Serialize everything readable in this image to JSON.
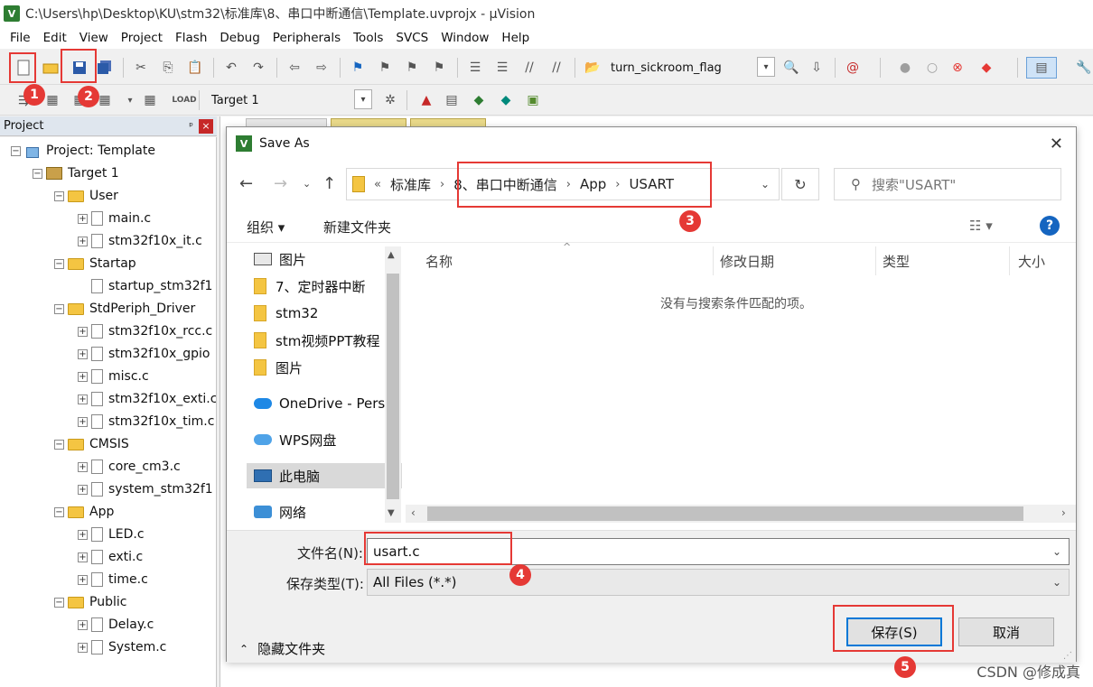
{
  "app": {
    "title": "C:\\Users\\hp\\Desktop\\KU\\stm32\\标准库\\8、串口中断通信\\Template.uvprojx - µVision",
    "icon_text": "V"
  },
  "menu": [
    "File",
    "Edit",
    "View",
    "Project",
    "Flash",
    "Debug",
    "Peripherals",
    "Tools",
    "SVCS",
    "Window",
    "Help"
  ],
  "toolbar": {
    "find_combo": "turn_sickroom_flag",
    "target_combo": "Target 1"
  },
  "project_panel": {
    "title": "Project",
    "pin": "ᵖ",
    "close": "×",
    "tree": [
      {
        "label": "Project: Template",
        "kind": "project",
        "pm": "−"
      },
      {
        "label": "Target 1",
        "kind": "target",
        "pm": "−"
      },
      {
        "label": "User",
        "kind": "folder",
        "pm": "−"
      },
      {
        "label": "main.c",
        "kind": "file",
        "pm": "+"
      },
      {
        "label": "stm32f10x_it.c",
        "kind": "file",
        "pm": "+"
      },
      {
        "label": "Startap",
        "kind": "folder",
        "pm": "−"
      },
      {
        "label": "startup_stm32f1",
        "kind": "file",
        "pm": ""
      },
      {
        "label": "StdPeriph_Driver",
        "kind": "folder",
        "pm": "−"
      },
      {
        "label": "stm32f10x_rcc.c",
        "kind": "file",
        "pm": "+"
      },
      {
        "label": "stm32f10x_gpio",
        "kind": "file",
        "pm": "+"
      },
      {
        "label": "misc.c",
        "kind": "file",
        "pm": "+"
      },
      {
        "label": "stm32f10x_exti.c",
        "kind": "file",
        "pm": "+"
      },
      {
        "label": "stm32f10x_tim.c",
        "kind": "file",
        "pm": "+"
      },
      {
        "label": "CMSIS",
        "kind": "folder",
        "pm": "−"
      },
      {
        "label": "core_cm3.c",
        "kind": "file",
        "pm": "+"
      },
      {
        "label": "system_stm32f1",
        "kind": "file",
        "pm": "+"
      },
      {
        "label": "App",
        "kind": "folder",
        "pm": "−"
      },
      {
        "label": "LED.c",
        "kind": "file",
        "pm": "+"
      },
      {
        "label": "exti.c",
        "kind": "file",
        "pm": "+"
      },
      {
        "label": "time.c",
        "kind": "file",
        "pm": "+"
      },
      {
        "label": "Public",
        "kind": "folder",
        "pm": "−"
      },
      {
        "label": "Delay.c",
        "kind": "file",
        "pm": "+"
      },
      {
        "label": "System.c",
        "kind": "file",
        "pm": "+"
      }
    ]
  },
  "dialog": {
    "title": "Save As",
    "close": "✕",
    "address": {
      "prefix": "«",
      "crumbs": [
        "标准库",
        "8、串口中断通信",
        "App",
        "USART"
      ]
    },
    "search_placeholder": "搜索\"USART\"",
    "organize": "组织 ▾",
    "new_folder": "新建文件夹",
    "help": "?",
    "nav_items": [
      {
        "label": "图片",
        "icon": "picture-icon"
      },
      {
        "label": "7、定时器中断",
        "icon": "folder-icon"
      },
      {
        "label": "stm32",
        "icon": "folder-icon"
      },
      {
        "label": "stm视频PPT教程",
        "icon": "folder-icon"
      },
      {
        "label": "图片",
        "icon": "folder-icon"
      },
      {
        "label": "OneDrive - Perso",
        "icon": "onedrive-icon"
      },
      {
        "label": "WPS网盘",
        "icon": "wps-cloud-icon"
      },
      {
        "label": "此电脑",
        "icon": "this-pc-icon"
      },
      {
        "label": "网络",
        "icon": "network-icon"
      }
    ],
    "columns": [
      "名称",
      "修改日期",
      "类型",
      "大小"
    ],
    "empty_message": "没有与搜索条件匹配的项。",
    "filename_label": "文件名(N):",
    "filename_value": "usart.c",
    "filetype_label": "保存类型(T):",
    "filetype_value": "All Files (*.*)",
    "hide_folders": "隐藏文件夹",
    "save_button": "保存(S)",
    "cancel_button": "取消"
  },
  "annotations": [
    "1",
    "2",
    "3",
    "4",
    "5"
  ],
  "watermark": "CSDN @修成真",
  "colors": {
    "annotation_red": "#e53935",
    "primary_blue": "#0078d7"
  }
}
